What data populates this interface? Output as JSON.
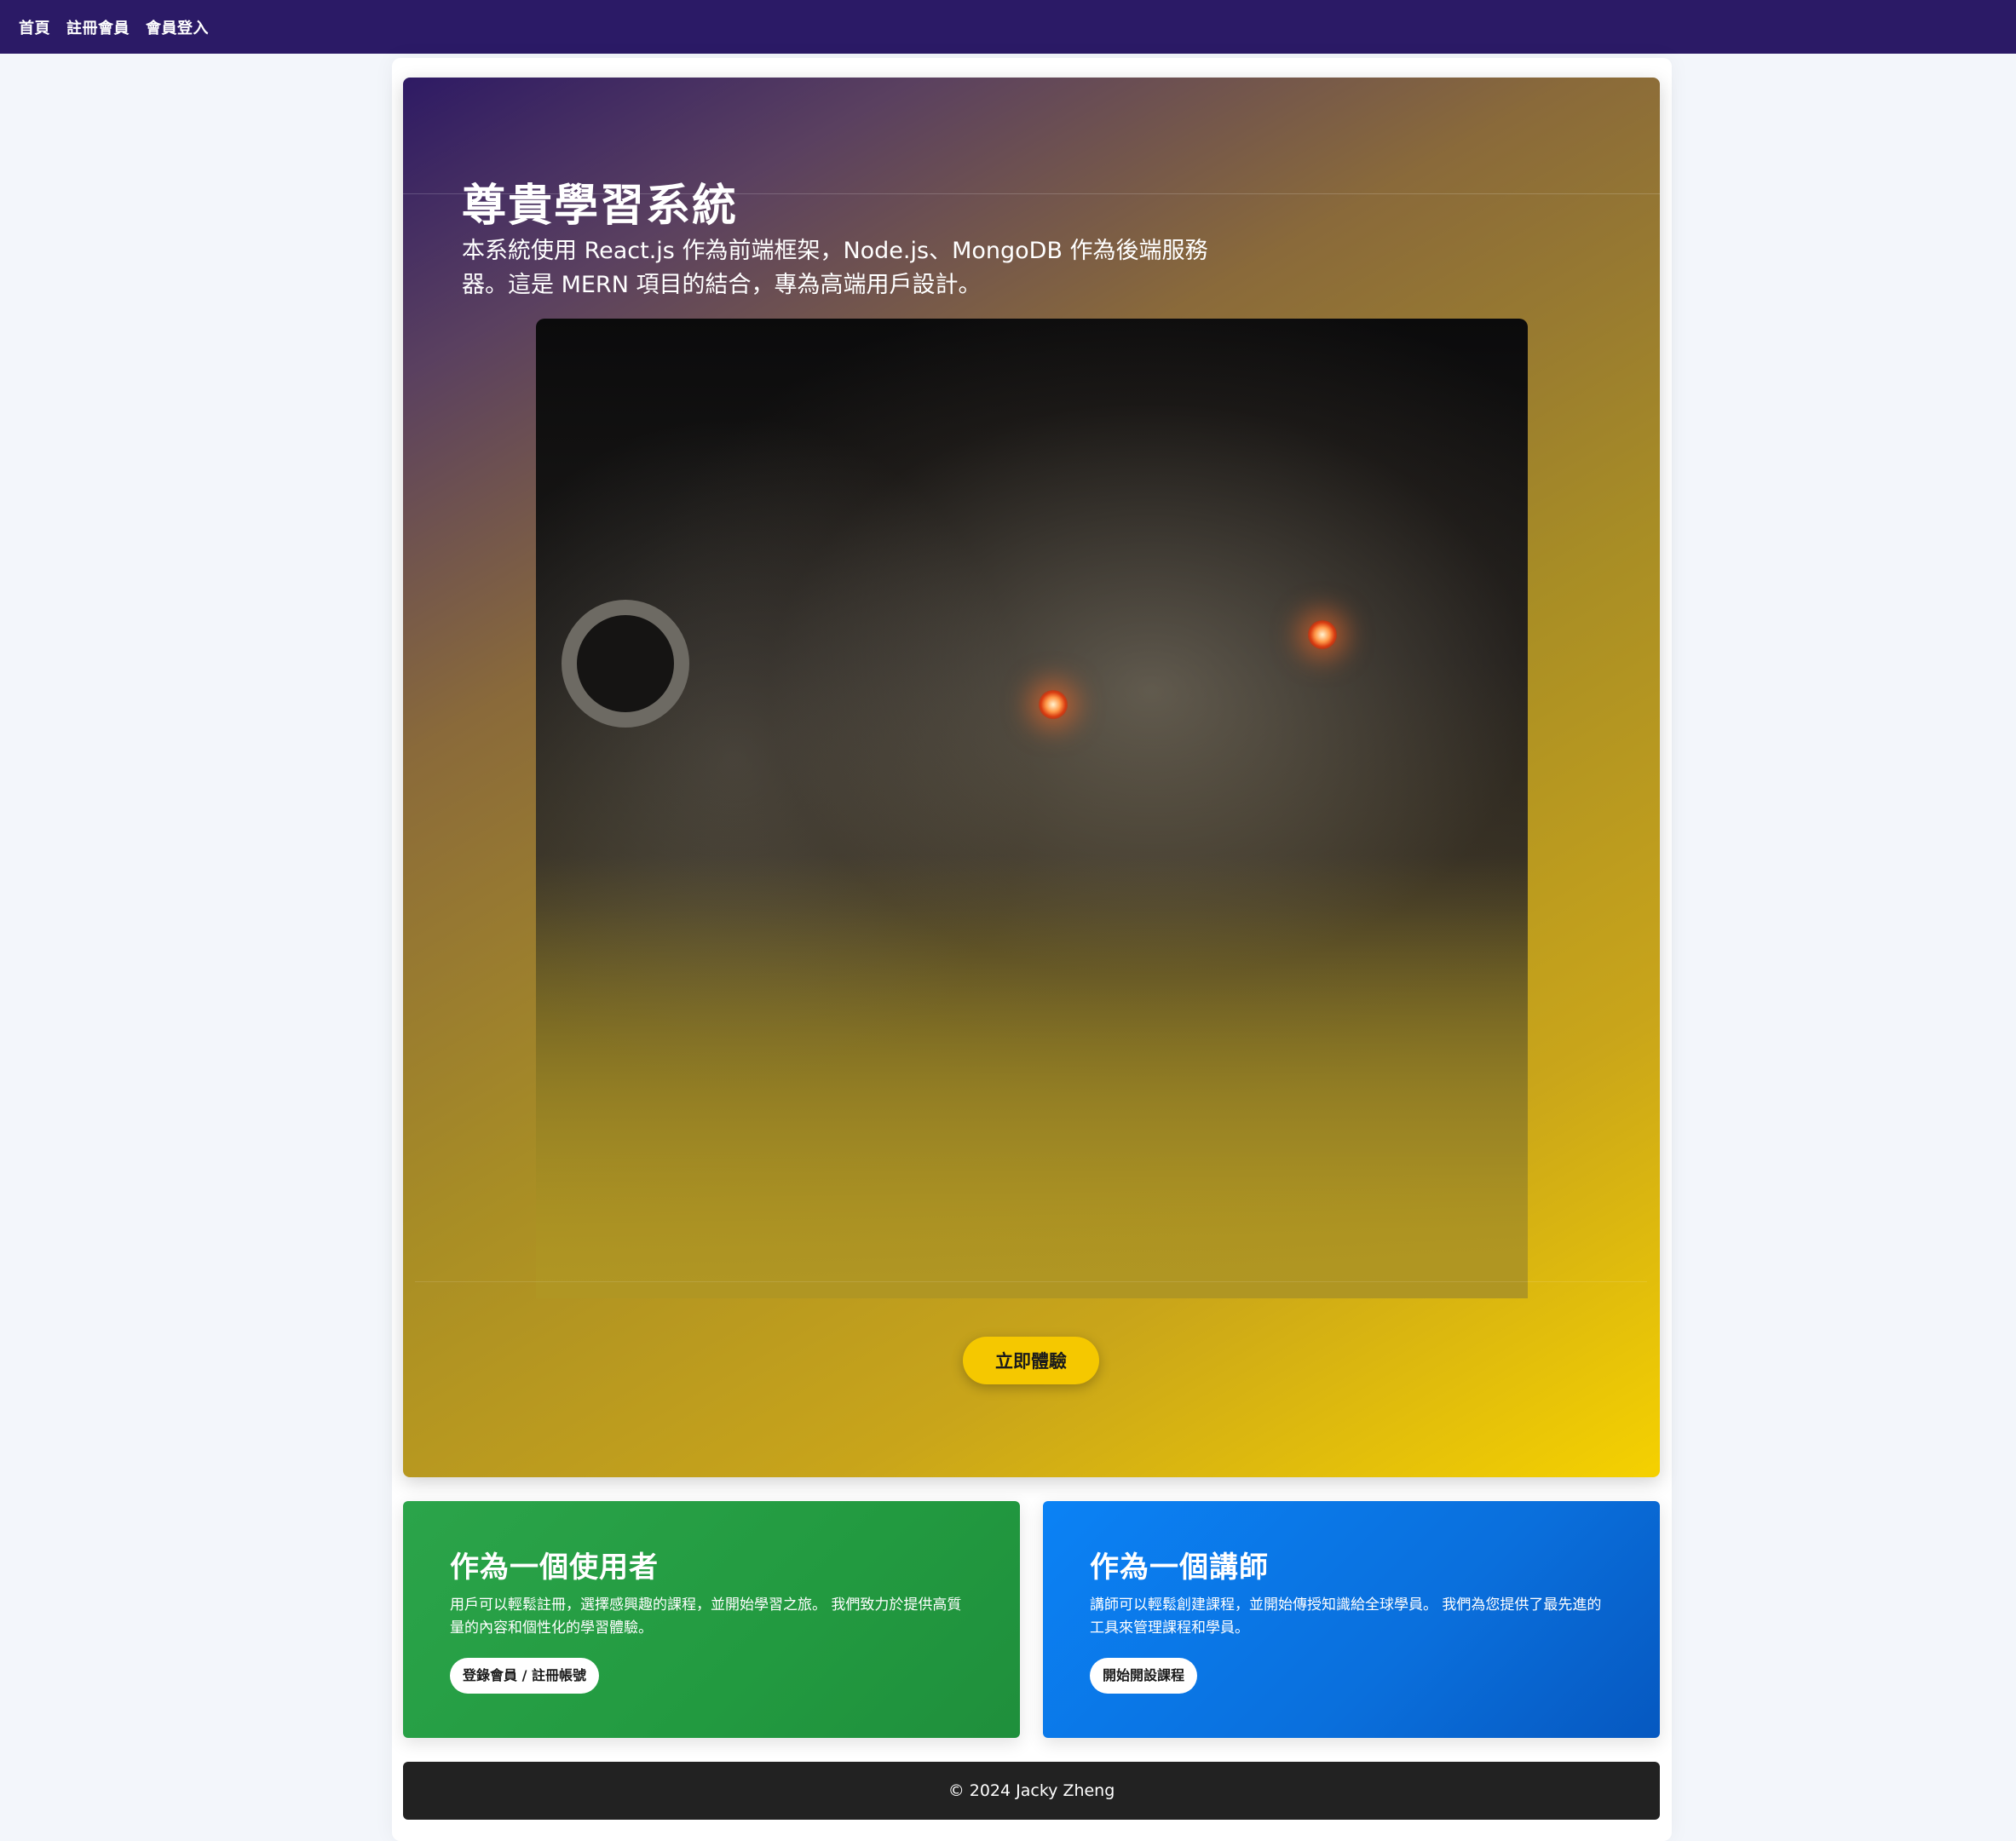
{
  "nav": {
    "items": [
      {
        "label": "首頁"
      },
      {
        "label": "註冊會員"
      },
      {
        "label": "會員登入"
      }
    ]
  },
  "hero": {
    "title": "尊貴學習系統",
    "description": "本系統使用 React.js 作為前端框架，Node.js、MongoDB 作為後端服務器。這是 MERN 項目的結合，專為高端用戶設計。",
    "cta_label": "立即體驗"
  },
  "cards": [
    {
      "title": "作為一個使用者",
      "text": "用戶可以輕鬆註冊，選擇感興趣的課程，並開始學習之旅。 我們致力於提供高質量的內容和個性化的學習體驗。",
      "button_label": "登錄會員 / 註冊帳號"
    },
    {
      "title": "作為一個講師",
      "text": "講師可以輕鬆創建課程，並開始傳授知識給全球學員。 我們為您提供了最先進的工具來管理課程和學員。",
      "button_label": "開始開設課程"
    }
  ],
  "footer": {
    "text": "© 2024 Jacky Zheng"
  },
  "colors": {
    "navbar": "#2b1a66",
    "cta": "#f5c800",
    "user_card": "#229a40",
    "teacher_card": "#0a6fdc",
    "footer": "#222222"
  }
}
